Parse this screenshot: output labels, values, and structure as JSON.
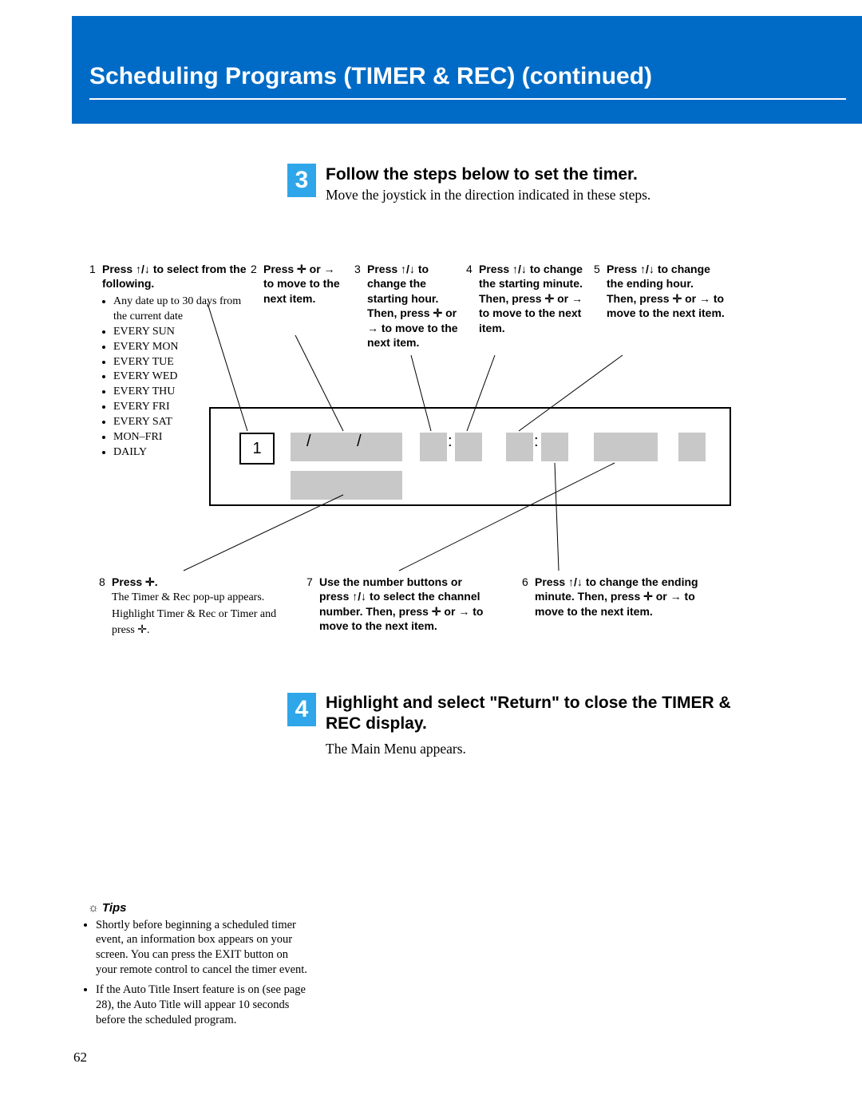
{
  "header": {
    "title": "Scheduling Programs (TIMER & REC) (continued)"
  },
  "step3": {
    "number": "3",
    "title": "Follow the steps below to set the timer.",
    "subtitle": "Move the joystick in the direction indicated in these steps."
  },
  "callouts": {
    "c1": {
      "num": "1",
      "bold": "Press ↑/↓ to select from the following.",
      "items": [
        "Any date up to 30 days from the current date",
        "EVERY SUN",
        "EVERY MON",
        "EVERY TUE",
        "EVERY WED",
        "EVERY THU",
        "EVERY FRI",
        "EVERY SAT",
        "MON–FRI",
        "DAILY"
      ]
    },
    "c2": {
      "num": "2",
      "bold": "Press ✛ or → to move to the next item."
    },
    "c3": {
      "num": "3",
      "bold": "Press ↑/↓ to change the starting hour. Then, press ✛ or → to move to the next item."
    },
    "c4": {
      "num": "4",
      "bold": "Press ↑/↓ to change the starting minute. Then, press ✛ or → to move to the next item."
    },
    "c5": {
      "num": "5",
      "bold": "Press ↑/↓ to change the ending hour. Then, press ✛ or → to move to the next item."
    },
    "c6": {
      "num": "6",
      "bold": "Press ↑/↓ to change the ending minute. Then, press ✛ or → to move to the next item."
    },
    "c7": {
      "num": "7",
      "bold": "Use the number buttons or press ↑/↓ to select the channel number. Then, press ✛ or → to move to the next item."
    },
    "c8": {
      "num": "8",
      "bold": "Press ✛.",
      "body1": "The Timer & Rec pop-up appears.",
      "body2": "Highlight Timer & Rec or Timer and press ✛."
    }
  },
  "display": {
    "index": "1",
    "date_sep": "/  /",
    "colon": ":"
  },
  "step4": {
    "number": "4",
    "title": "Highlight and select \"Return\" to close the TIMER & REC display.",
    "subtitle": "The Main Menu appears."
  },
  "tips": {
    "heading": "Tips",
    "items": [
      "Shortly before beginning a scheduled timer event, an information box appears on your screen. You can press the EXIT button on your remote control to cancel the timer event.",
      "If the Auto Title Insert feature is on (see page 28), the Auto Title will appear 10 seconds before the scheduled program."
    ]
  },
  "page_number": "62"
}
